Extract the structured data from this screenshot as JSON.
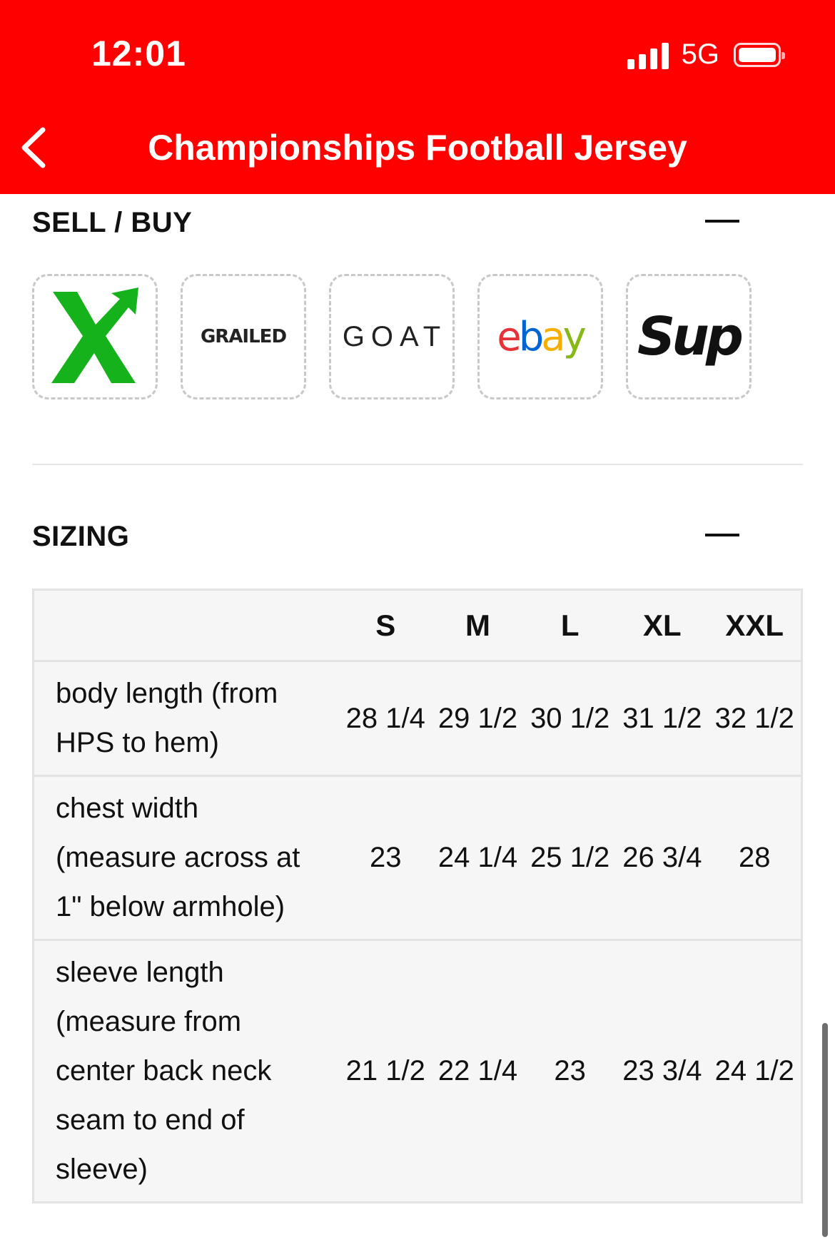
{
  "status_bar": {
    "time": "12:01",
    "network": "5G"
  },
  "header": {
    "title": "Championships Football Jersey"
  },
  "sell_buy": {
    "title": "SELL / BUY",
    "platforms": [
      {
        "name": "stockx",
        "label": "X"
      },
      {
        "name": "grailed",
        "label": "GRAILED"
      },
      {
        "name": "goat",
        "label": "GOAT"
      },
      {
        "name": "ebay",
        "letters": [
          "e",
          "b",
          "a",
          "y"
        ],
        "colors": [
          "#e53238",
          "#0064d2",
          "#f5af02",
          "#86b817"
        ]
      },
      {
        "name": "supreme",
        "label": "Sup"
      }
    ]
  },
  "sizing": {
    "title": "SIZING",
    "columns": [
      "S",
      "M",
      "L",
      "XL",
      "XXL"
    ],
    "rows": [
      {
        "label": "body length (from HPS to hem)",
        "values": [
          "28 1/4",
          "29 1/2",
          "30 1/2",
          "31 1/2",
          "32 1/2"
        ]
      },
      {
        "label": "chest width (measure across at 1\" below armhole)",
        "values": [
          "23",
          "24 1/4",
          "25 1/2",
          "26 3/4",
          "28"
        ]
      },
      {
        "label": "sleeve length (measure from center back neck seam to end of sleeve)",
        "values": [
          "21 1/2",
          "22 1/4",
          "23",
          "23 3/4",
          "24 1/2"
        ]
      }
    ]
  },
  "colors": {
    "header_bg": "#ff0000",
    "table_bg": "#f6f6f6"
  }
}
